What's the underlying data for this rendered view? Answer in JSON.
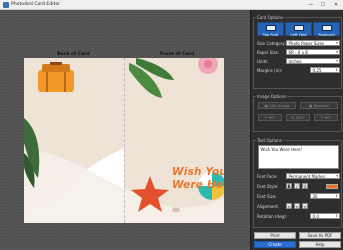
{
  "window": {
    "title": "Photo4ed Card Editor",
    "controls": {
      "minimize": "—",
      "maximize": "☐",
      "close": "✕"
    }
  },
  "canvas": {
    "back_label": "Back of Card",
    "front_label": "Front of Card",
    "card_text_line1": "Wish You",
    "card_text_line2": "Were Here",
    "text_color": "#e8782a"
  },
  "card_options": {
    "title": "Card Options",
    "fold_buttons": [
      {
        "label": "Top Fold"
      },
      {
        "label": "Left Fold"
      },
      {
        "label": "Postcard"
      }
    ],
    "size_category_label": "Size Category:",
    "size_category_value": "Photo Paper Sizes",
    "paper_size_label": "Paper Size:",
    "paper_size_value": "6R - 6 x 8",
    "units_label": "Units:",
    "units_value": "Inches",
    "margins_label": "Margins (in):",
    "margins_value": "0.25"
  },
  "image_options": {
    "title": "Image Options",
    "add_image": "Add Image",
    "remove": "Remove",
    "rotate_left": "90°",
    "rotate_180": "180°",
    "rotate_right": "90°"
  },
  "text_options": {
    "title": "Text Options",
    "text_value": "Wish You Were Here!",
    "font_face_label": "Font Face:",
    "font_face_value": "Permanent Marker",
    "font_style_label": "Font Style:",
    "bold": "B",
    "italic": "I",
    "underline": "U",
    "font_color": "#f07020",
    "font_size_label": "Font Size:",
    "font_size_value": "30",
    "alignment_label": "Alignment:",
    "rotation_label": "Rotation (deg):",
    "rotation_value": "0.0"
  },
  "actions": {
    "print": "Print",
    "save_pdf": "Save As PDF",
    "create": "Create",
    "help": "Help"
  }
}
